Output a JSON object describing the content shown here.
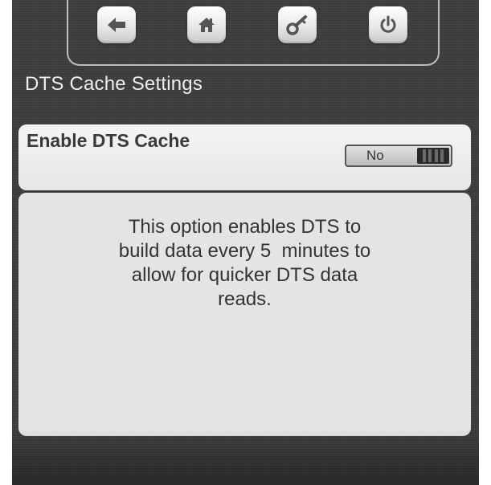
{
  "colors": {
    "screen_background": "#3e3e3e",
    "panel_background": "#e4e4e4",
    "text_dark": "#333333",
    "title_text": "#eeeeee"
  },
  "nav": {
    "buttons": [
      {
        "name": "back",
        "icon": "arrow-left-icon"
      },
      {
        "name": "home",
        "icon": "home-icon"
      },
      {
        "name": "security",
        "icon": "key-icon"
      },
      {
        "name": "power",
        "icon": "power-icon"
      }
    ]
  },
  "page": {
    "title": "DTS Cache Settings"
  },
  "setting": {
    "label": "Enable DTS Cache",
    "toggle_value": "No"
  },
  "info": {
    "lines": [
      "This option enables DTS to",
      "build data every 5  minutes to",
      "allow for quicker DTS data",
      "reads."
    ]
  }
}
